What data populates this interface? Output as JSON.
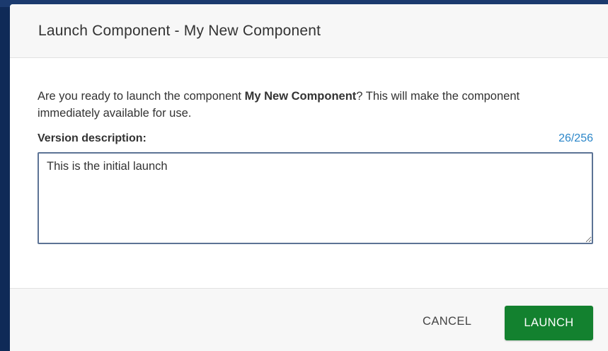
{
  "dialog": {
    "title": "Launch Component - My New Component",
    "message_prefix": "Are you ready to launch the component ",
    "message_component_name": "My New Component",
    "message_suffix": "? This will make the component immediately available for use.",
    "field_label": "Version description:",
    "char_count": "26/256",
    "description_value": "This is the initial launch",
    "cancel_label": "CANCEL",
    "launch_label": "LAUNCH"
  },
  "colors": {
    "backdrop": "#0f2a57",
    "launch_button": "#13812f",
    "char_count": "#2a86c9",
    "textarea_border": "#5c7395"
  }
}
